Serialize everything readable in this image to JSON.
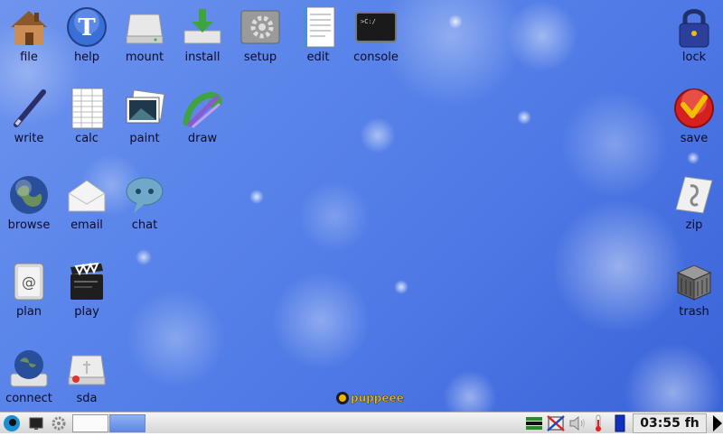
{
  "desktop": {
    "icons_left": [
      {
        "label": "file",
        "icon": "home-folder-icon"
      },
      {
        "label": "help",
        "icon": "help-icon"
      },
      {
        "label": "mount",
        "icon": "drive-icon"
      },
      {
        "label": "install",
        "icon": "install-icon"
      },
      {
        "label": "setup",
        "icon": "setup-icon"
      },
      {
        "label": "edit",
        "icon": "text-editor-icon"
      },
      {
        "label": "console",
        "icon": "console-icon"
      },
      {
        "label": "write",
        "icon": "pen-icon"
      },
      {
        "label": "calc",
        "icon": "spreadsheet-icon"
      },
      {
        "label": "paint",
        "icon": "photo-icon"
      },
      {
        "label": "draw",
        "icon": "draw-icon"
      },
      {
        "label": "browse",
        "icon": "globe-icon"
      },
      {
        "label": "email",
        "icon": "envelope-icon"
      },
      {
        "label": "chat",
        "icon": "chat-bubble-icon"
      },
      {
        "label": "plan",
        "icon": "address-book-icon"
      },
      {
        "label": "play",
        "icon": "clapperboard-icon"
      },
      {
        "label": "connect",
        "icon": "network-globe-icon"
      },
      {
        "label": "sda",
        "icon": "usb-drive-icon"
      }
    ],
    "icons_right": [
      {
        "label": "lock",
        "icon": "padlock-icon"
      },
      {
        "label": "save",
        "icon": "save-check-icon"
      },
      {
        "label": "zip",
        "icon": "zip-archive-icon"
      },
      {
        "label": "trash",
        "icon": "trash-bin-icon"
      }
    ],
    "logo_text": "puppeee",
    "background_colors": [
      "#6f94ee",
      "#4f7ae6",
      "#3a63d8"
    ]
  },
  "taskbar": {
    "clock": "03:55 fh",
    "tray_icons": [
      "network-icon",
      "firewall-icon",
      "volume-icon",
      "temperature-icon",
      "battery-icon"
    ],
    "left_icons": [
      "start-menu-icon",
      "show-desktop-icon",
      "settings-gear-icon"
    ]
  }
}
